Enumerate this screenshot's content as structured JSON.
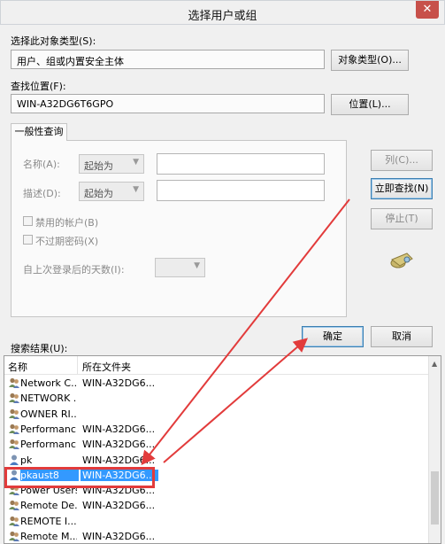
{
  "window": {
    "title": "选择用户或组",
    "close_glyph": "✕"
  },
  "object_type": {
    "label": "选择此对象类型(S):",
    "value": "用户、组或内置安全主体",
    "button": "对象类型(O)..."
  },
  "location": {
    "label": "查找位置(F):",
    "value": "WIN-A32DG6T6GPO",
    "button": "位置(L)..."
  },
  "tab": {
    "label": "一般性查询"
  },
  "query": {
    "name_label": "名称(A):",
    "name_combo": "起始为",
    "desc_label": "描述(D):",
    "desc_combo": "起始为",
    "disabled_accounts": "禁用的帐户(B)",
    "no_expire_password": "不过期密码(X)",
    "days_since_login": "自上次登录后的天数(I):"
  },
  "side_buttons": {
    "columns": "列(C)...",
    "find_now": "立即查找(N)",
    "stop": "停止(T)"
  },
  "results_label": "搜索结果(U):",
  "ok": "确定",
  "cancel": "取消",
  "results": {
    "col_name": "名称",
    "col_folder": "所在文件夹",
    "rows": [
      {
        "name": "Network C...",
        "folder": "WIN-A32DG6...",
        "icon": "group-icon"
      },
      {
        "name": "NETWORK ...",
        "folder": "",
        "icon": "group-icon"
      },
      {
        "name": "OWNER RI...",
        "folder": "",
        "icon": "group-icon"
      },
      {
        "name": "Performanc...",
        "folder": "WIN-A32DG6...",
        "icon": "group-icon"
      },
      {
        "name": "Performanc...",
        "folder": "WIN-A32DG6...",
        "icon": "group-icon"
      },
      {
        "name": "pk",
        "folder": "WIN-A32DG6...",
        "icon": "user-icon"
      },
      {
        "name": "pkaust8",
        "folder": "WIN-A32DG6...",
        "icon": "user-icon",
        "selected": true
      },
      {
        "name": "Power Users",
        "folder": "WIN-A32DG6...",
        "icon": "group-icon"
      },
      {
        "name": "Remote De...",
        "folder": "WIN-A32DG6...",
        "icon": "group-icon"
      },
      {
        "name": "REMOTE I...",
        "folder": "",
        "icon": "group-icon"
      },
      {
        "name": "Remote M...",
        "folder": "WIN-A32DG6...",
        "icon": "group-icon"
      }
    ]
  },
  "colors": {
    "selection": "#3399ff",
    "annotation": "#e23b3b"
  }
}
